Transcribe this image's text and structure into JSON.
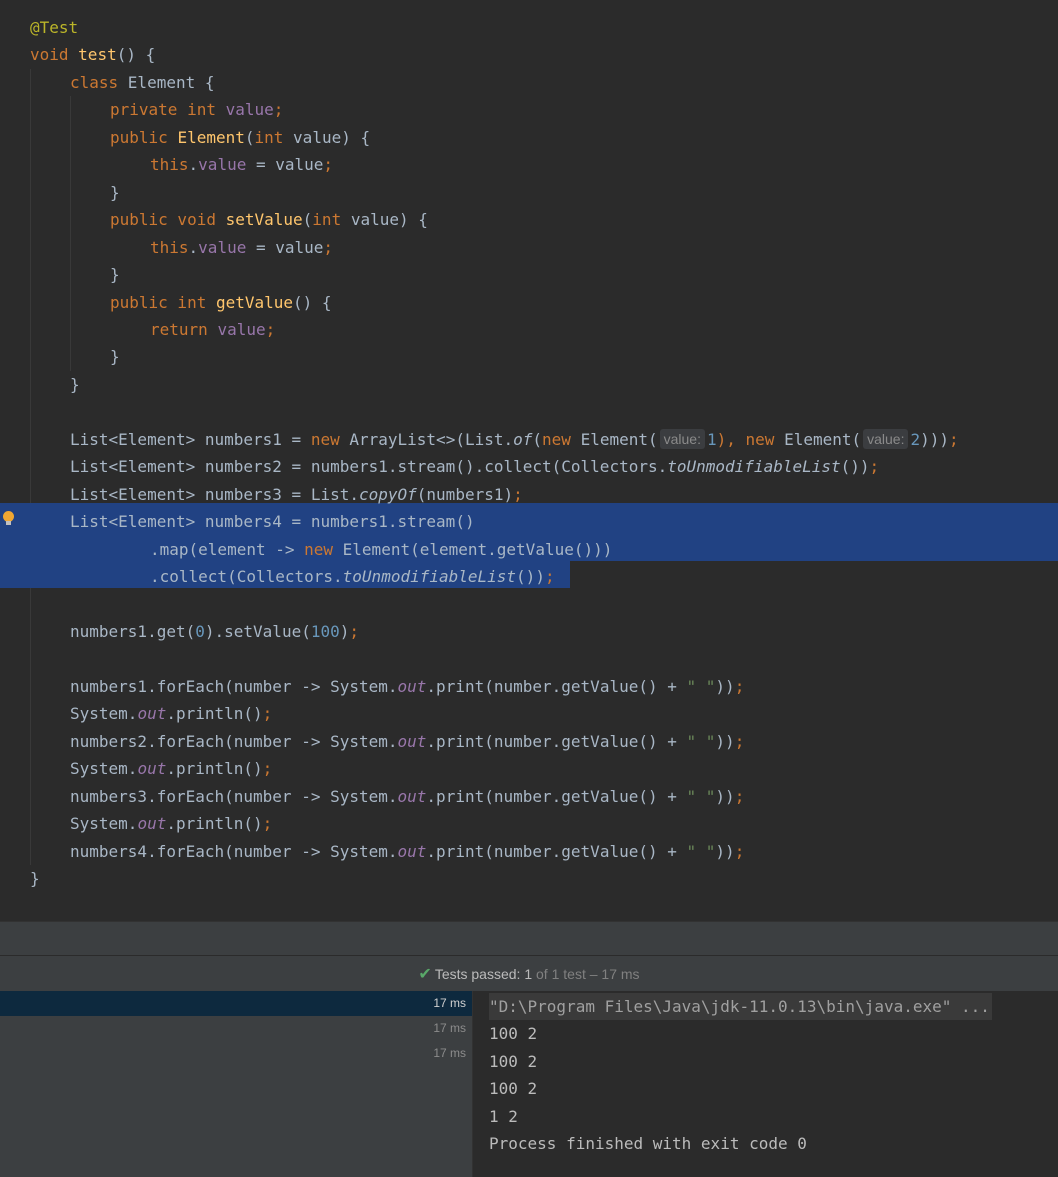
{
  "editor": {
    "lines": [
      {
        "indent": 0,
        "tokens": [
          {
            "t": "@Test",
            "c": "ann"
          }
        ]
      },
      {
        "indent": 0,
        "tokens": [
          {
            "t": "void ",
            "c": "kw"
          },
          {
            "t": "test",
            "c": "fn"
          },
          {
            "t": "() {",
            "c": ""
          }
        ]
      },
      {
        "indent": 1,
        "tokens": [
          {
            "t": "class ",
            "c": "kw"
          },
          {
            "t": "Element {",
            "c": ""
          }
        ]
      },
      {
        "indent": 2,
        "tokens": [
          {
            "t": "private int ",
            "c": "kw"
          },
          {
            "t": "value",
            "c": "fld"
          },
          {
            "t": ";",
            "c": "kw"
          }
        ]
      },
      {
        "indent": 2,
        "tokens": [
          {
            "t": "public ",
            "c": "kw"
          },
          {
            "t": "Element",
            "c": "fn"
          },
          {
            "t": "(",
            "c": ""
          },
          {
            "t": "int ",
            "c": "kw"
          },
          {
            "t": "value) {",
            "c": ""
          }
        ]
      },
      {
        "indent": 3,
        "tokens": [
          {
            "t": "this",
            "c": "kw"
          },
          {
            "t": ".",
            "c": ""
          },
          {
            "t": "value",
            "c": "fld"
          },
          {
            "t": " = value",
            "c": ""
          },
          {
            "t": ";",
            "c": "kw"
          }
        ]
      },
      {
        "indent": 2,
        "tokens": [
          {
            "t": "}",
            "c": ""
          }
        ]
      },
      {
        "indent": 2,
        "tokens": [
          {
            "t": "public void ",
            "c": "kw"
          },
          {
            "t": "setValue",
            "c": "fn"
          },
          {
            "t": "(",
            "c": ""
          },
          {
            "t": "int ",
            "c": "kw"
          },
          {
            "t": "value) {",
            "c": ""
          }
        ]
      },
      {
        "indent": 3,
        "tokens": [
          {
            "t": "this",
            "c": "kw"
          },
          {
            "t": ".",
            "c": ""
          },
          {
            "t": "value",
            "c": "fld"
          },
          {
            "t": " = value",
            "c": ""
          },
          {
            "t": ";",
            "c": "kw"
          }
        ]
      },
      {
        "indent": 2,
        "tokens": [
          {
            "t": "}",
            "c": ""
          }
        ]
      },
      {
        "indent": 2,
        "tokens": [
          {
            "t": "public int ",
            "c": "kw"
          },
          {
            "t": "getValue",
            "c": "fn"
          },
          {
            "t": "() {",
            "c": ""
          }
        ]
      },
      {
        "indent": 3,
        "tokens": [
          {
            "t": "return ",
            "c": "kw"
          },
          {
            "t": "value",
            "c": "fld"
          },
          {
            "t": ";",
            "c": "kw"
          }
        ]
      },
      {
        "indent": 2,
        "tokens": [
          {
            "t": "}",
            "c": ""
          }
        ]
      },
      {
        "indent": 1,
        "tokens": [
          {
            "t": "}",
            "c": ""
          }
        ]
      },
      {
        "indent": 0,
        "tokens": []
      },
      {
        "indent": 1,
        "tokens": [
          {
            "t": "List<Element> numbers1 = ",
            "c": ""
          },
          {
            "t": "new ",
            "c": "kw"
          },
          {
            "t": "ArrayList<>(List.",
            "c": ""
          },
          {
            "t": "of",
            "c": "ital"
          },
          {
            "t": "(",
            "c": ""
          },
          {
            "t": "new ",
            "c": "kw"
          },
          {
            "t": "Element(",
            "c": ""
          },
          {
            "t": "value:",
            "c": "hint"
          },
          {
            "t": "1",
            "c": "num"
          },
          {
            "t": "), ",
            "c": "kw"
          },
          {
            "t": "new ",
            "c": "kw"
          },
          {
            "t": "Element(",
            "c": ""
          },
          {
            "t": "value:",
            "c": "hint"
          },
          {
            "t": "2",
            "c": "num"
          },
          {
            "t": ")))",
            "c": ""
          },
          {
            "t": ";",
            "c": "kw"
          }
        ]
      },
      {
        "indent": 1,
        "tokens": [
          {
            "t": "List<Element> numbers2 = numbers1.stream().collect(Collectors.",
            "c": ""
          },
          {
            "t": "toUnmodifiableList",
            "c": "ital"
          },
          {
            "t": "())",
            "c": ""
          },
          {
            "t": ";",
            "c": "kw"
          }
        ]
      },
      {
        "indent": 1,
        "tokens": [
          {
            "t": "List<Element> numbers3 = List.",
            "c": ""
          },
          {
            "t": "copyOf",
            "c": "ital"
          },
          {
            "t": "(numbers1)",
            "c": ""
          },
          {
            "t": ";",
            "c": "kw"
          }
        ]
      },
      {
        "indent": 1,
        "tokens": [
          {
            "t": "List<Element> numbers4 = numbers1.stream()",
            "c": ""
          }
        ]
      },
      {
        "indent": 3,
        "tokens": [
          {
            "t": ".map(element -> ",
            "c": ""
          },
          {
            "t": "new ",
            "c": "kw"
          },
          {
            "t": "Element(element.getValue()))",
            "c": ""
          }
        ]
      },
      {
        "indent": 3,
        "tokens": [
          {
            "t": ".collect(Collectors.",
            "c": ""
          },
          {
            "t": "toUnmodifiableList",
            "c": "ital"
          },
          {
            "t": "())",
            "c": ""
          },
          {
            "t": ";",
            "c": "kw"
          }
        ]
      },
      {
        "indent": 0,
        "tokens": []
      },
      {
        "indent": 1,
        "tokens": [
          {
            "t": "numbers1.get(",
            "c": ""
          },
          {
            "t": "0",
            "c": "num"
          },
          {
            "t": ").setValue(",
            "c": ""
          },
          {
            "t": "100",
            "c": "num"
          },
          {
            "t": ")",
            "c": ""
          },
          {
            "t": ";",
            "c": "kw"
          }
        ]
      },
      {
        "indent": 0,
        "tokens": []
      },
      {
        "indent": 1,
        "tokens": [
          {
            "t": "numbers1.forEach(number -> System.",
            "c": ""
          },
          {
            "t": "out",
            "c": "fld ital"
          },
          {
            "t": ".print(number.getValue() + ",
            "c": ""
          },
          {
            "t": "\" \"",
            "c": "str"
          },
          {
            "t": "))",
            "c": ""
          },
          {
            "t": ";",
            "c": "kw"
          }
        ]
      },
      {
        "indent": 1,
        "tokens": [
          {
            "t": "System.",
            "c": ""
          },
          {
            "t": "out",
            "c": "fld ital"
          },
          {
            "t": ".println()",
            "c": ""
          },
          {
            "t": ";",
            "c": "kw"
          }
        ]
      },
      {
        "indent": 1,
        "tokens": [
          {
            "t": "numbers2.forEach(number -> System.",
            "c": ""
          },
          {
            "t": "out",
            "c": "fld ital"
          },
          {
            "t": ".print(number.getValue() + ",
            "c": ""
          },
          {
            "t": "\" \"",
            "c": "str"
          },
          {
            "t": "))",
            "c": ""
          },
          {
            "t": ";",
            "c": "kw"
          }
        ]
      },
      {
        "indent": 1,
        "tokens": [
          {
            "t": "System.",
            "c": ""
          },
          {
            "t": "out",
            "c": "fld ital"
          },
          {
            "t": ".println()",
            "c": ""
          },
          {
            "t": ";",
            "c": "kw"
          }
        ]
      },
      {
        "indent": 1,
        "tokens": [
          {
            "t": "numbers3.forEach(number -> System.",
            "c": ""
          },
          {
            "t": "out",
            "c": "fld ital"
          },
          {
            "t": ".print(number.getValue() + ",
            "c": ""
          },
          {
            "t": "\" \"",
            "c": "str"
          },
          {
            "t": "))",
            "c": ""
          },
          {
            "t": ";",
            "c": "kw"
          }
        ]
      },
      {
        "indent": 1,
        "tokens": [
          {
            "t": "System.",
            "c": ""
          },
          {
            "t": "out",
            "c": "fld ital"
          },
          {
            "t": ".println()",
            "c": ""
          },
          {
            "t": ";",
            "c": "kw"
          }
        ]
      },
      {
        "indent": 1,
        "tokens": [
          {
            "t": "numbers4.forEach(number -> System.",
            "c": ""
          },
          {
            "t": "out",
            "c": "fld ital"
          },
          {
            "t": ".print(number.getValue() + ",
            "c": ""
          },
          {
            "t": "\" \"",
            "c": "str"
          },
          {
            "t": "))",
            "c": ""
          },
          {
            "t": ";",
            "c": "kw"
          }
        ]
      },
      {
        "indent": 0,
        "tokens": [
          {
            "t": "}",
            "c": ""
          }
        ]
      }
    ],
    "selected_lines": [
      18,
      19,
      20
    ],
    "gutter_icon": "intention-bulb-icon"
  },
  "status": {
    "check_icon": "check-icon",
    "label": "Tests passed:",
    "passed": "1",
    "of_text": "of",
    "total": "1",
    "test_word": "test",
    "duration": "– 17 ms"
  },
  "test_tree": {
    "rows": [
      {
        "time": "17 ms",
        "selected": true
      },
      {
        "time": "17 ms",
        "selected": false
      },
      {
        "time": "17 ms",
        "selected": false
      }
    ]
  },
  "console": {
    "command": "\"D:\\Program Files\\Java\\jdk-11.0.13\\bin\\java.exe\" ...",
    "output": [
      "100 2",
      "100 2",
      "100 2",
      "1 2",
      "Process finished with exit code 0"
    ]
  }
}
